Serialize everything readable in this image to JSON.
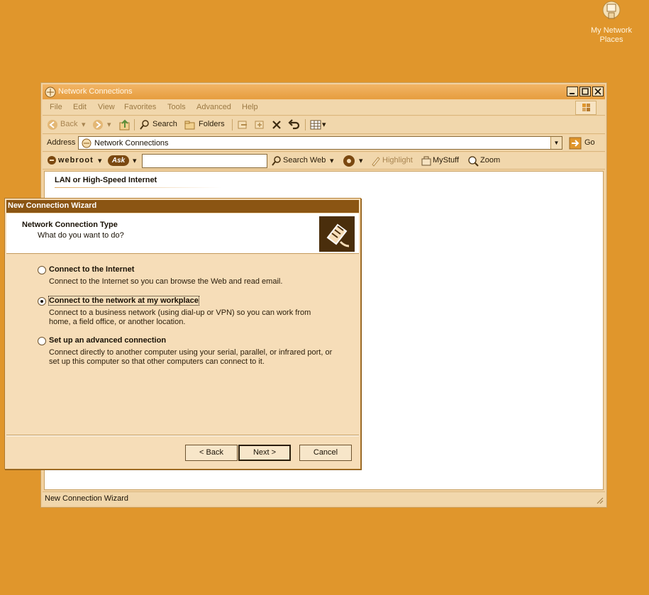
{
  "desktop": {
    "icon_label_line1": "My Network",
    "icon_label_line2": "Places"
  },
  "explorer": {
    "title": "Network Connections",
    "menu": [
      "File",
      "Edit",
      "View",
      "Favorites",
      "Tools",
      "Advanced",
      "Help"
    ],
    "toolbar": {
      "back": "Back",
      "search": "Search",
      "folders": "Folders"
    },
    "address": {
      "label": "Address",
      "value": "Network Connections",
      "go": "Go"
    },
    "webbar": {
      "brand": "webroot",
      "ask": "Ask",
      "search_web": "Search Web",
      "highlight": "Highlight",
      "mystuff": "MyStuff",
      "zoom": "Zoom"
    },
    "content": {
      "group_title": "LAN or High-Speed Internet"
    },
    "status": "New Connection Wizard"
  },
  "wizard": {
    "title": "New Connection Wizard",
    "header_title": "Network Connection Type",
    "header_subtitle": "What do you want to do?",
    "options": [
      {
        "label": "Connect to the Internet",
        "desc": "Connect to the Internet so you can browse the Web and read email.",
        "selected": false
      },
      {
        "label": "Connect to the network at my workplace",
        "desc": "Connect to a business network (using dial-up or VPN) so you can work from home, a field office, or another location.",
        "selected": true
      },
      {
        "label": "Set up an advanced connection",
        "desc": "Connect directly to another computer using your serial, parallel, or infrared port, or set up this computer so that other computers can connect to it.",
        "selected": false
      }
    ],
    "buttons": {
      "back": "< Back",
      "next": "Next >",
      "cancel": "Cancel"
    }
  },
  "colors": {
    "desktop": "#E0962C",
    "wizard_title": "#8B5513"
  }
}
